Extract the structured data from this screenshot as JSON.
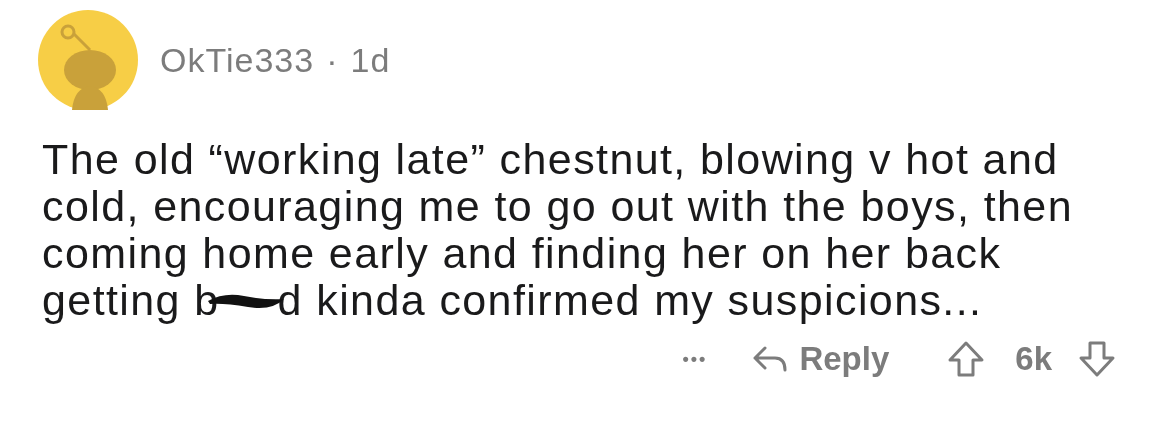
{
  "comment": {
    "author": "OkTie333",
    "separator": "·",
    "age": "1d",
    "lines": [
      "The old “working late” chestnut, blowing v hot and",
      "cold, encouraging me to go out with the boys, then",
      "coming home early and finding her on her back"
    ],
    "last_line_before": "getting b",
    "last_line_after": "d kinda confirmed my suspicions...",
    "actions": {
      "more": "•••",
      "reply": "Reply",
      "score": "6k"
    }
  }
}
